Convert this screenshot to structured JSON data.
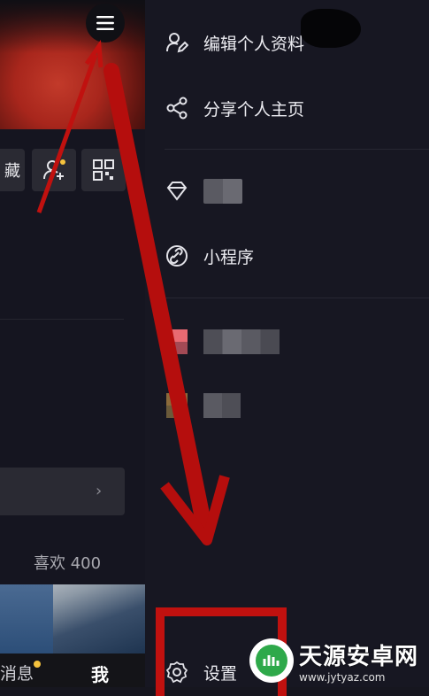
{
  "left_panel": {
    "collection_tab_fragment": "藏",
    "likes_label": "喜欢 400",
    "bottom_nav": {
      "messages_label": "消息",
      "me_label": "我"
    }
  },
  "drawer": {
    "items": [
      {
        "label": "编辑个人资料",
        "icon": "user-edit-icon"
      },
      {
        "label": "分享个人主页",
        "icon": "share-icon"
      },
      {
        "label": "",
        "icon": "diamond-icon"
      },
      {
        "label": "小程序",
        "icon": "link-icon"
      },
      {
        "label": "",
        "icon": "pixelated-app-icon"
      },
      {
        "label": "",
        "icon": "pixelated-app-icon"
      }
    ],
    "settings_label": "设置"
  },
  "watermark": {
    "name": "天源安卓网",
    "url": "www.jytyaz.com"
  },
  "colors": {
    "annotation_red": "#c0110f",
    "drawer_bg": "#171722",
    "notify_dot": "#f5c23d"
  }
}
